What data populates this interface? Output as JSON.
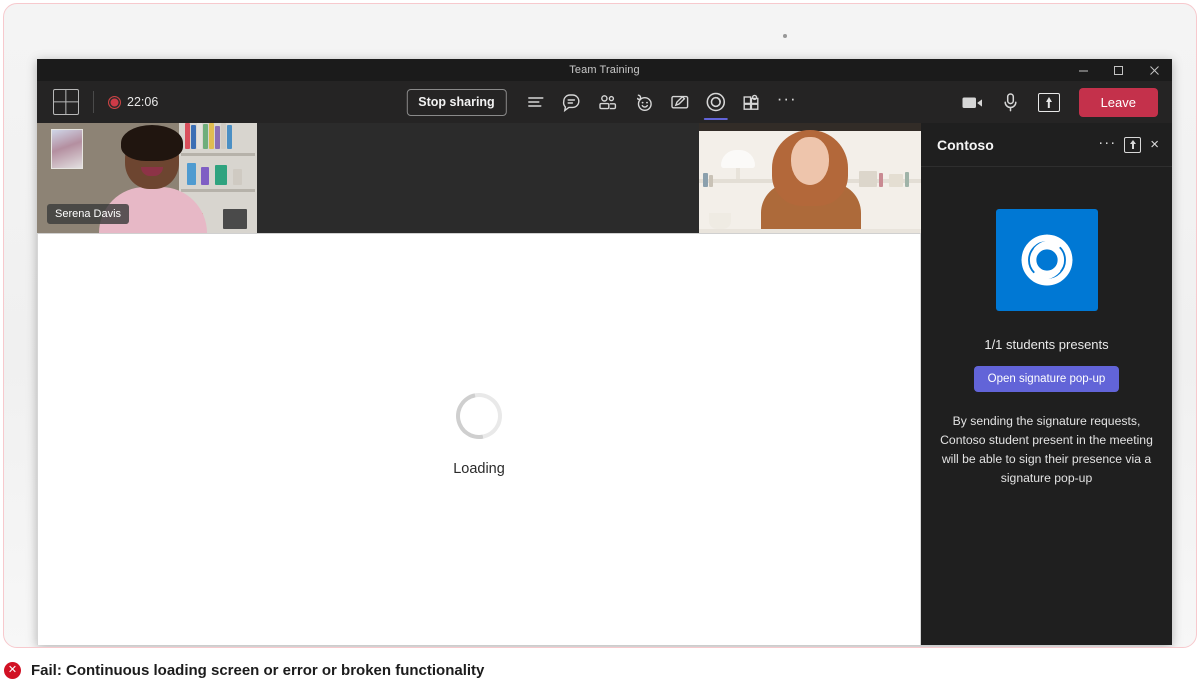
{
  "window": {
    "title": "Team Training",
    "controls": {
      "minimize": "minimize-icon",
      "maximize": "maximize-icon",
      "close": "close-icon"
    }
  },
  "toolbar": {
    "layout_icon": "grid-layout-icon",
    "recording_time": "22:06",
    "recording_icon": "record-dot-icon",
    "stop_sharing_label": "Stop sharing",
    "center_icons": [
      {
        "name": "agenda-icon",
        "label": "Agenda",
        "active": false
      },
      {
        "name": "chat-icon",
        "label": "Chat",
        "active": false
      },
      {
        "name": "people-icon",
        "label": "People",
        "active": false
      },
      {
        "name": "reactions-icon",
        "label": "Reactions",
        "active": false
      },
      {
        "name": "whiteboard-icon",
        "label": "Whiteboard",
        "active": false
      },
      {
        "name": "contoso-app-icon",
        "label": "Contoso",
        "active": true
      },
      {
        "name": "apps-icon",
        "label": "Apps",
        "active": false
      }
    ],
    "more_label": "···",
    "camera_icon": "camera-icon",
    "mic_icon": "microphone-icon",
    "share_icon": "share-screen-icon",
    "leave_label": "Leave"
  },
  "stage": {
    "videos": [
      {
        "name": "Serena Davis"
      },
      {
        "name": ""
      }
    ],
    "shared_content": {
      "spinner_icon": "loading-spinner-icon",
      "loading_label": "Loading"
    }
  },
  "side_panel": {
    "title": "Contoso",
    "more_label": "···",
    "popout_icon": "pop-out-icon",
    "close_label": "×",
    "logo_icon": "contoso-swirl-logo",
    "logo_color": "#0078d4",
    "presents_text": "1/1 students presents",
    "cta_label": "Open signature pop-up",
    "cta_color": "#6264d8",
    "description": "By sending the signature requests, Contoso student present in the meeting will  be able to sign their presence via a signature pop-up"
  },
  "fail_banner": {
    "icon": "error-circle-icon",
    "icon_color": "#d11124",
    "glyph": "✕",
    "text": "Fail: Continuous loading screen or error or broken functionality"
  }
}
